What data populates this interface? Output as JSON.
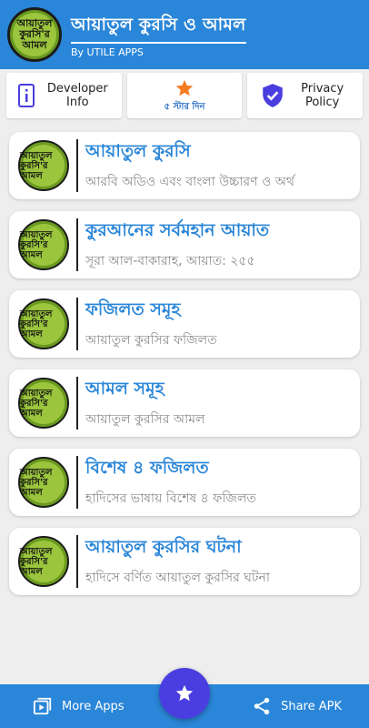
{
  "header": {
    "title": "আয়াতুল কুরসি ও আমল",
    "subtitle": "By UTILE APPS",
    "logo_text": "আয়াতুল কুরসি'র আমল"
  },
  "top_buttons": {
    "developer": "Developer Info",
    "rate": "৫ স্টার দিন",
    "privacy": "Privacy Policy"
  },
  "items": [
    {
      "title": "আয়াতুল কুরসি",
      "subtitle": "আরবি অডিও এবং বাংলা উচ্চারণ ও অর্থ"
    },
    {
      "title": "কুরআনের সর্বমহান আয়াত",
      "subtitle": "সূরা আল-বাকারাহ, আয়াত: ২৫৫"
    },
    {
      "title": "ফজিলত সমূহ",
      "subtitle": "আয়াতুল কুরসির ফজিলত"
    },
    {
      "title": "আমল সমূহ",
      "subtitle": "আয়াতুল কুরসির আমল"
    },
    {
      "title": "বিশেষ ৪ ফজিলত",
      "subtitle": "হাদিসের ভাষায় বিশেষ ৪ ফজিলত"
    },
    {
      "title": "আয়াতুল কুরসির ঘটনা",
      "subtitle": "হাদিসে বর্ণিত আয়াতুল কুরসির ঘটনা"
    }
  ],
  "bottom": {
    "more_apps": "More Apps",
    "share": "Share APK"
  },
  "colors": {
    "primary": "#2a86d8",
    "fab": "#4a3ee0",
    "logo_green": "#9bc53d",
    "star_orange": "#f47b20"
  }
}
